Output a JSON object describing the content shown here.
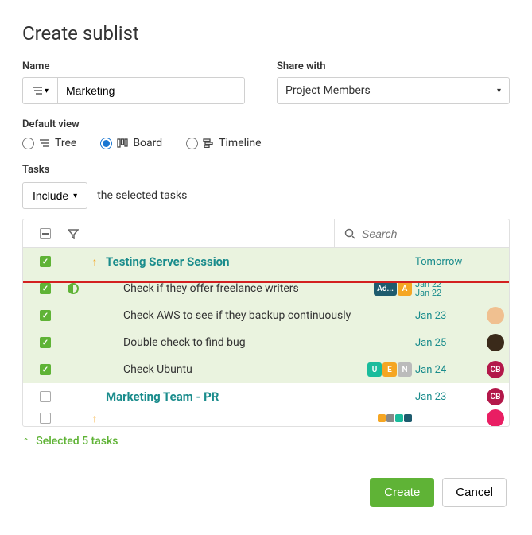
{
  "title": "Create sublist",
  "fields": {
    "name_label": "Name",
    "name_value": "Marketing",
    "share_label": "Share with",
    "share_value": "Project Members",
    "view_label": "Default view",
    "views": {
      "tree": "Tree",
      "board": "Board",
      "timeline": "Timeline",
      "selected": "board"
    }
  },
  "tasks_section": {
    "label": "Tasks",
    "include_label": "Include",
    "include_suffix": "the selected tasks",
    "search_placeholder": "Search"
  },
  "tasks": [
    {
      "checked": true,
      "group": true,
      "arrow": true,
      "title": "Testing Server Session",
      "date": "Tomorrow",
      "tags": [],
      "avatar": null
    },
    {
      "checked": true,
      "status": true,
      "title": "Check if they offer freelance writers",
      "date": "Jan 22 - Jan 22",
      "tags": [
        {
          "text": "Ad...",
          "bg": "#1e5b6e"
        },
        {
          "text": "A",
          "bg": "#f5a623"
        }
      ],
      "avatar": null
    },
    {
      "checked": true,
      "title": "Check AWS to see if they backup continuously",
      "date": "Jan 23",
      "tags": [],
      "avatar": {
        "bg": "#f0c090",
        "text": ""
      }
    },
    {
      "checked": true,
      "title": "Double check to find bug",
      "date": "Jan 25",
      "tags": [],
      "avatar": {
        "bg": "#3a2a1a",
        "text": ""
      }
    },
    {
      "checked": true,
      "title": "Check Ubuntu",
      "date": "Jan 24",
      "tags": [
        {
          "text": "U",
          "bg": "#1abc9c"
        },
        {
          "text": "E",
          "bg": "#f5a623"
        },
        {
          "text": "N",
          "bg": "#bbb"
        }
      ],
      "avatar": {
        "bg": "#b3184a",
        "text": "CB"
      }
    },
    {
      "checked": false,
      "group": true,
      "title": "Marketing Team - PR",
      "date": "Jan 23",
      "tags": [],
      "avatar": {
        "bg": "#b3184a",
        "text": "CB"
      }
    },
    {
      "checked": false,
      "arrow": true,
      "title": "",
      "date": "",
      "tags": [
        {
          "text": "",
          "bg": "#f5a623"
        },
        {
          "text": "",
          "bg": "#888"
        },
        {
          "text": "",
          "bg": "#1abc9c"
        },
        {
          "text": "",
          "bg": "#1e5b6e"
        }
      ],
      "avatar": {
        "bg": "#e91e63",
        "text": ""
      },
      "cut": true
    }
  ],
  "selected_text": "Selected 5 tasks",
  "buttons": {
    "create": "Create",
    "cancel": "Cancel"
  },
  "colors": {
    "accent": "#5fb336",
    "teal": "#1a8c8c"
  }
}
